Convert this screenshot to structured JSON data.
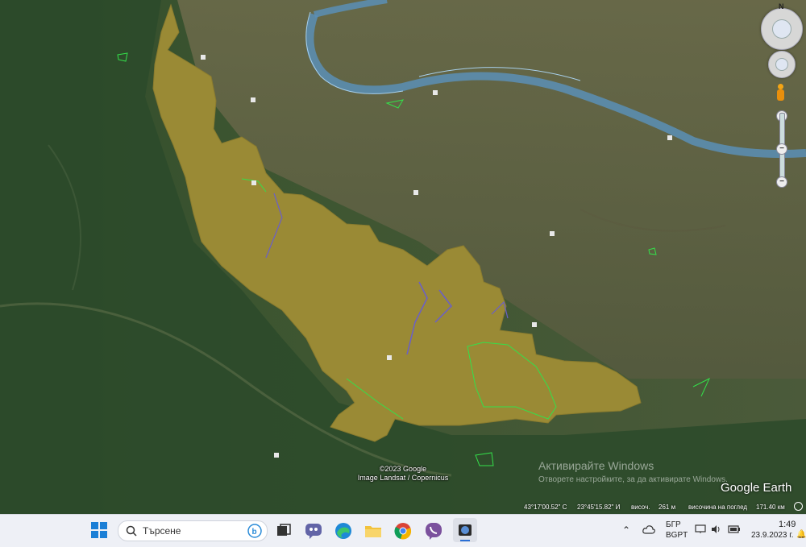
{
  "map": {
    "copyright_line1": "©2023 Google",
    "copyright_line2": "Image Landsat / Copernicus",
    "brand": "Google Earth",
    "compass_letter": "N"
  },
  "windows_notice": {
    "title": "Активирайте Windows",
    "subtitle": "Отворете настройките, за да активирате Windows."
  },
  "status": {
    "latitude": "43°17'00.52\" С",
    "longitude": "23°45'15.82\" И",
    "elevation_label": "височ.",
    "elevation_value": "261 м",
    "eye_alt_label": "височина на поглед",
    "eye_alt_value": "171.40 км"
  },
  "taskbar": {
    "search_placeholder": "Търсене",
    "language_1": "БГР",
    "language_2": "BGPT",
    "time": "1:49",
    "date": "23.9.2023 г."
  },
  "colors": {
    "region_fill": "#9a8a35",
    "river": "#6ea3c9",
    "outline_green": "#34e04a"
  }
}
